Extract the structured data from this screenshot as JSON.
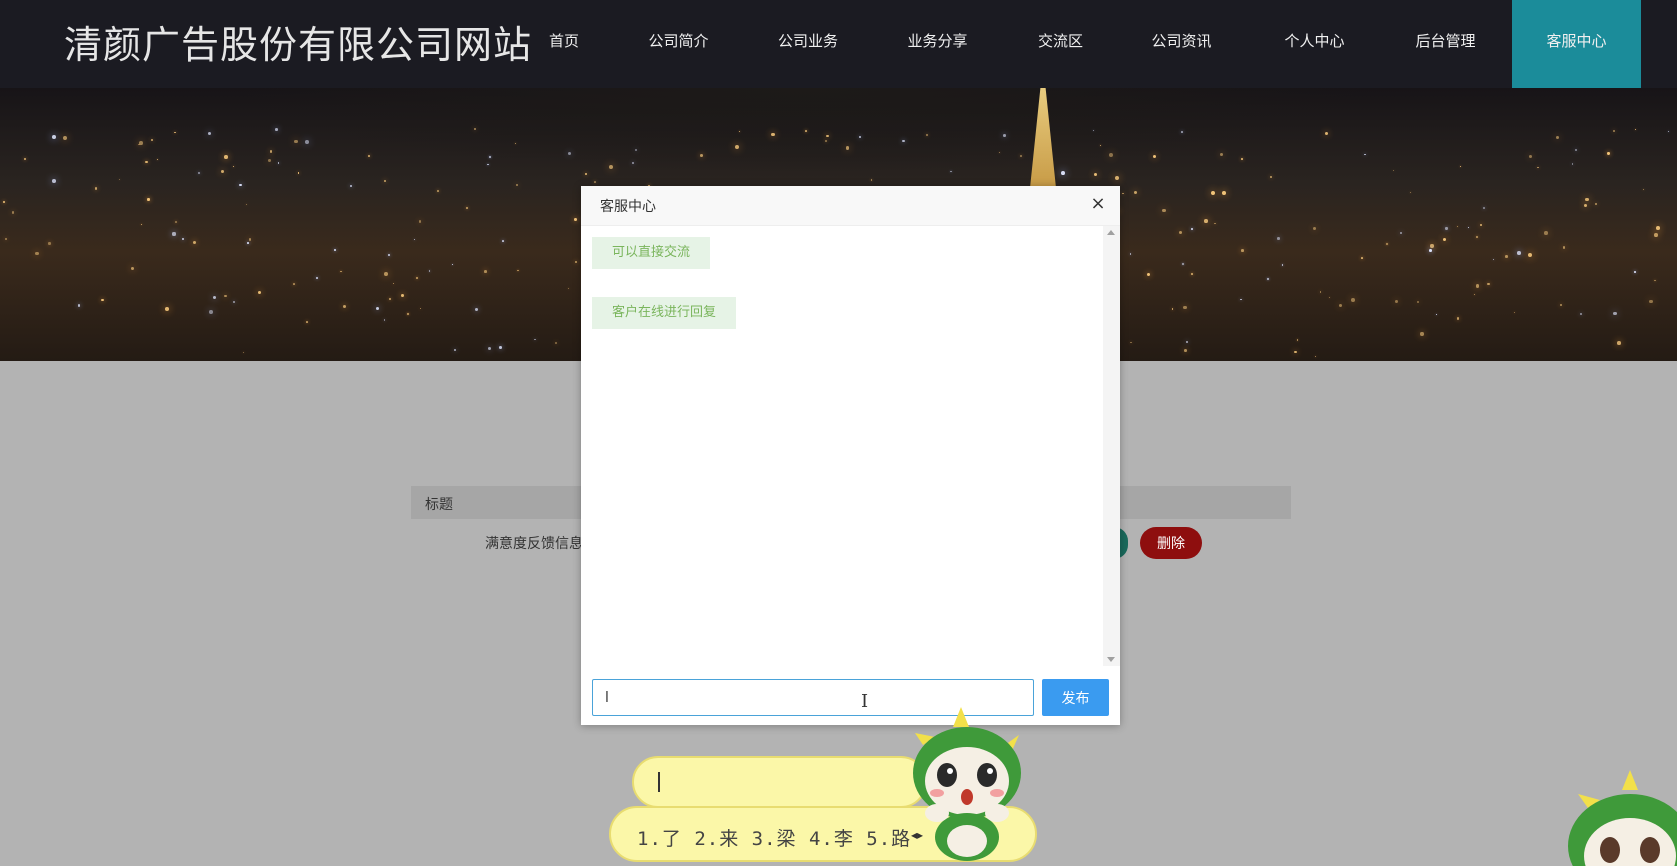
{
  "header": {
    "site_title": "清颜广告股份有限公司网站",
    "nav": [
      {
        "label": "首页",
        "active": false
      },
      {
        "label": "公司简介",
        "active": false
      },
      {
        "label": "公司业务",
        "active": false
      },
      {
        "label": "业务分享",
        "active": false
      },
      {
        "label": "交流区",
        "active": false
      },
      {
        "label": "公司资讯",
        "active": false
      },
      {
        "label": "个人中心",
        "active": false
      },
      {
        "label": "后台管理",
        "active": false
      },
      {
        "label": "客服中心",
        "active": true
      }
    ]
  },
  "content": {
    "table_header": "标题",
    "row_title": "满意度反馈信息",
    "delete_label": "删除"
  },
  "dialog": {
    "title": "客服中心",
    "close_glyph": "×",
    "messages": [
      "可以直接交流",
      "客户在线进行回复"
    ],
    "input_value": "l",
    "send_label": "发布"
  },
  "ime": {
    "candidates": "1.了 2.来 3.梁 4.李 5.路",
    "arrows": "◂▸"
  },
  "colors": {
    "header_bg": "#1b1b22",
    "nav_active": "#1b8c9a",
    "send_button": "#3a9bf0",
    "delete_button": "#8e0e0e",
    "message_bg": "#e6f3e6",
    "message_text": "#7ab55c"
  }
}
